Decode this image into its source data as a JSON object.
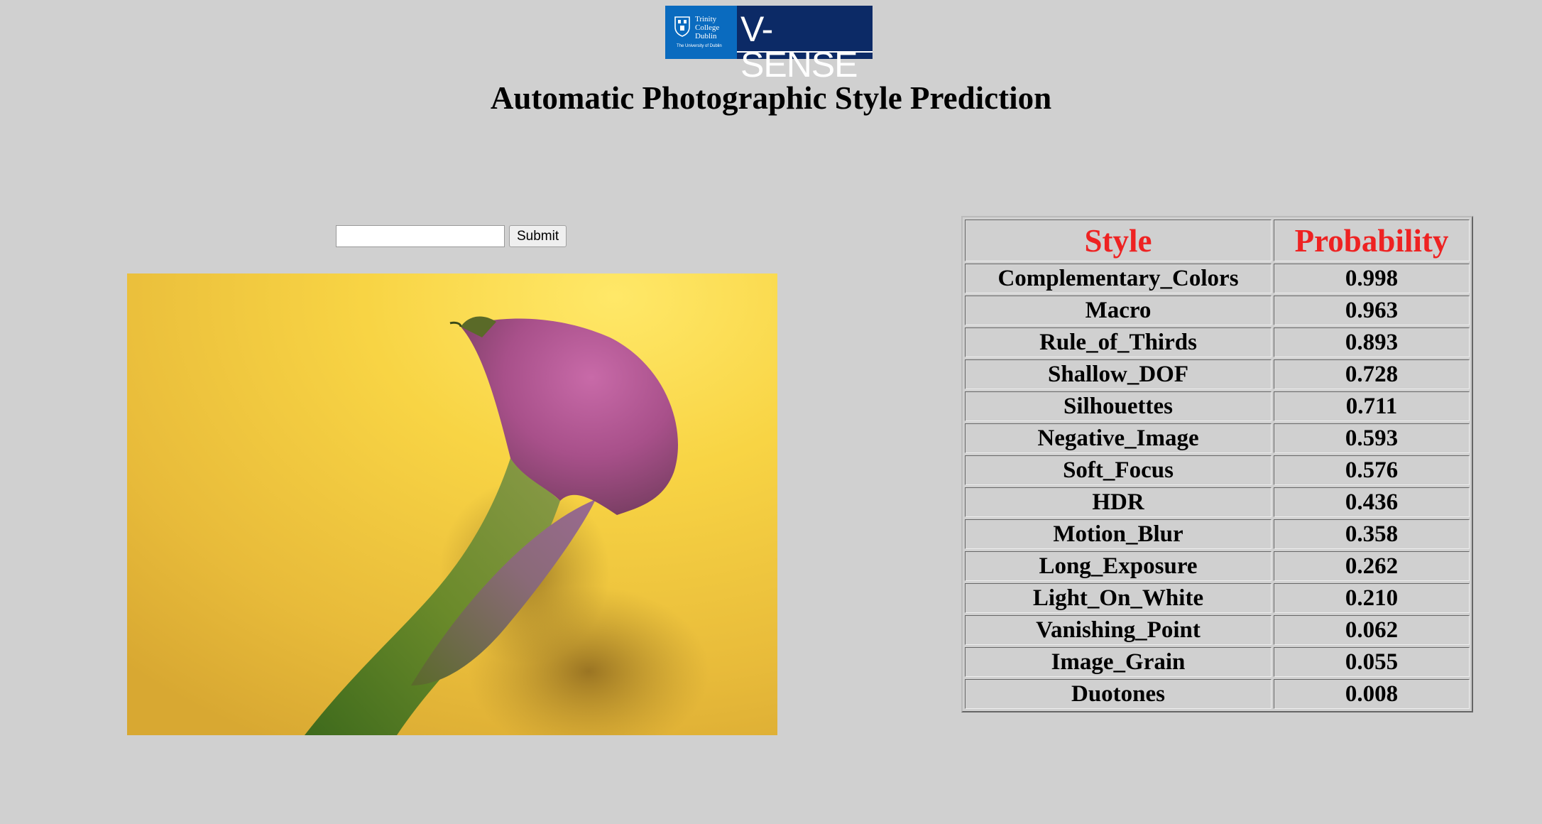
{
  "logo": {
    "institution_lines": [
      "Trinity",
      "College",
      "Dublin"
    ],
    "institution_sub": "The University of Dublin",
    "brand_text": "V-SENSE"
  },
  "page_title": "Automatic Photographic Style Prediction",
  "form": {
    "url_value": "",
    "url_placeholder": "",
    "submit_label": "Submit"
  },
  "photo": {
    "description_icon": "calla-lily-photo"
  },
  "table": {
    "headers": [
      "Style",
      "Probability"
    ],
    "header_color": "#ee2222",
    "rows": [
      {
        "style": "Complementary_Colors",
        "probability": "0.998"
      },
      {
        "style": "Macro",
        "probability": "0.963"
      },
      {
        "style": "Rule_of_Thirds",
        "probability": "0.893"
      },
      {
        "style": "Shallow_DOF",
        "probability": "0.728"
      },
      {
        "style": "Silhouettes",
        "probability": "0.711"
      },
      {
        "style": "Negative_Image",
        "probability": "0.593"
      },
      {
        "style": "Soft_Focus",
        "probability": "0.576"
      },
      {
        "style": "HDR",
        "probability": "0.436"
      },
      {
        "style": "Motion_Blur",
        "probability": "0.358"
      },
      {
        "style": "Long_Exposure",
        "probability": "0.262"
      },
      {
        "style": "Light_On_White",
        "probability": "0.210"
      },
      {
        "style": "Vanishing_Point",
        "probability": "0.062"
      },
      {
        "style": "Image_Grain",
        "probability": "0.055"
      },
      {
        "style": "Duotones",
        "probability": "0.008"
      }
    ]
  }
}
